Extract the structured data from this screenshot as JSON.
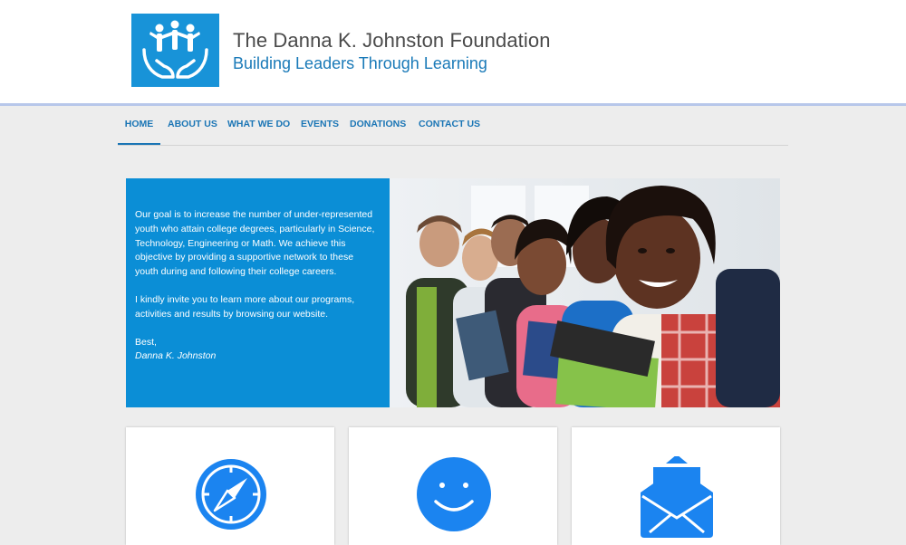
{
  "header": {
    "logo_icon": "hands-holding-people-logo",
    "title": "The Danna K. Johnston Foundation",
    "tagline": "Building Leaders Through Learning"
  },
  "nav": {
    "items": [
      {
        "label": "HOME",
        "active": true
      },
      {
        "label": "ABOUT US",
        "active": false
      },
      {
        "label": "WHAT WE DO",
        "active": false
      },
      {
        "label": "EVENTS",
        "active": false
      },
      {
        "label": "DONATIONS",
        "active": false
      },
      {
        "label": "CONTACT US",
        "active": false
      }
    ]
  },
  "hero": {
    "paragraph1": "Our goal is to increase the number of under-represented youth who attain college degrees, particularly in Science, Technology, Engineering or Math. We achieve this objective by providing a supportive network to these youth during and following their college careers.",
    "paragraph2": "I kindly invite you to learn more about our programs, activities and results by browsing our website.",
    "closing": "Best,",
    "signature": "Danna K. Johnston",
    "image": "students-holding-books-photo"
  },
  "cards": [
    {
      "icon": "compass-icon"
    },
    {
      "icon": "smiley-icon"
    },
    {
      "icon": "envelope-icon"
    }
  ],
  "colors": {
    "accent": "#0b8ed6",
    "nav_text": "#1a75b5",
    "icon_blue": "#1b84f0",
    "page_bg": "#ededed"
  }
}
